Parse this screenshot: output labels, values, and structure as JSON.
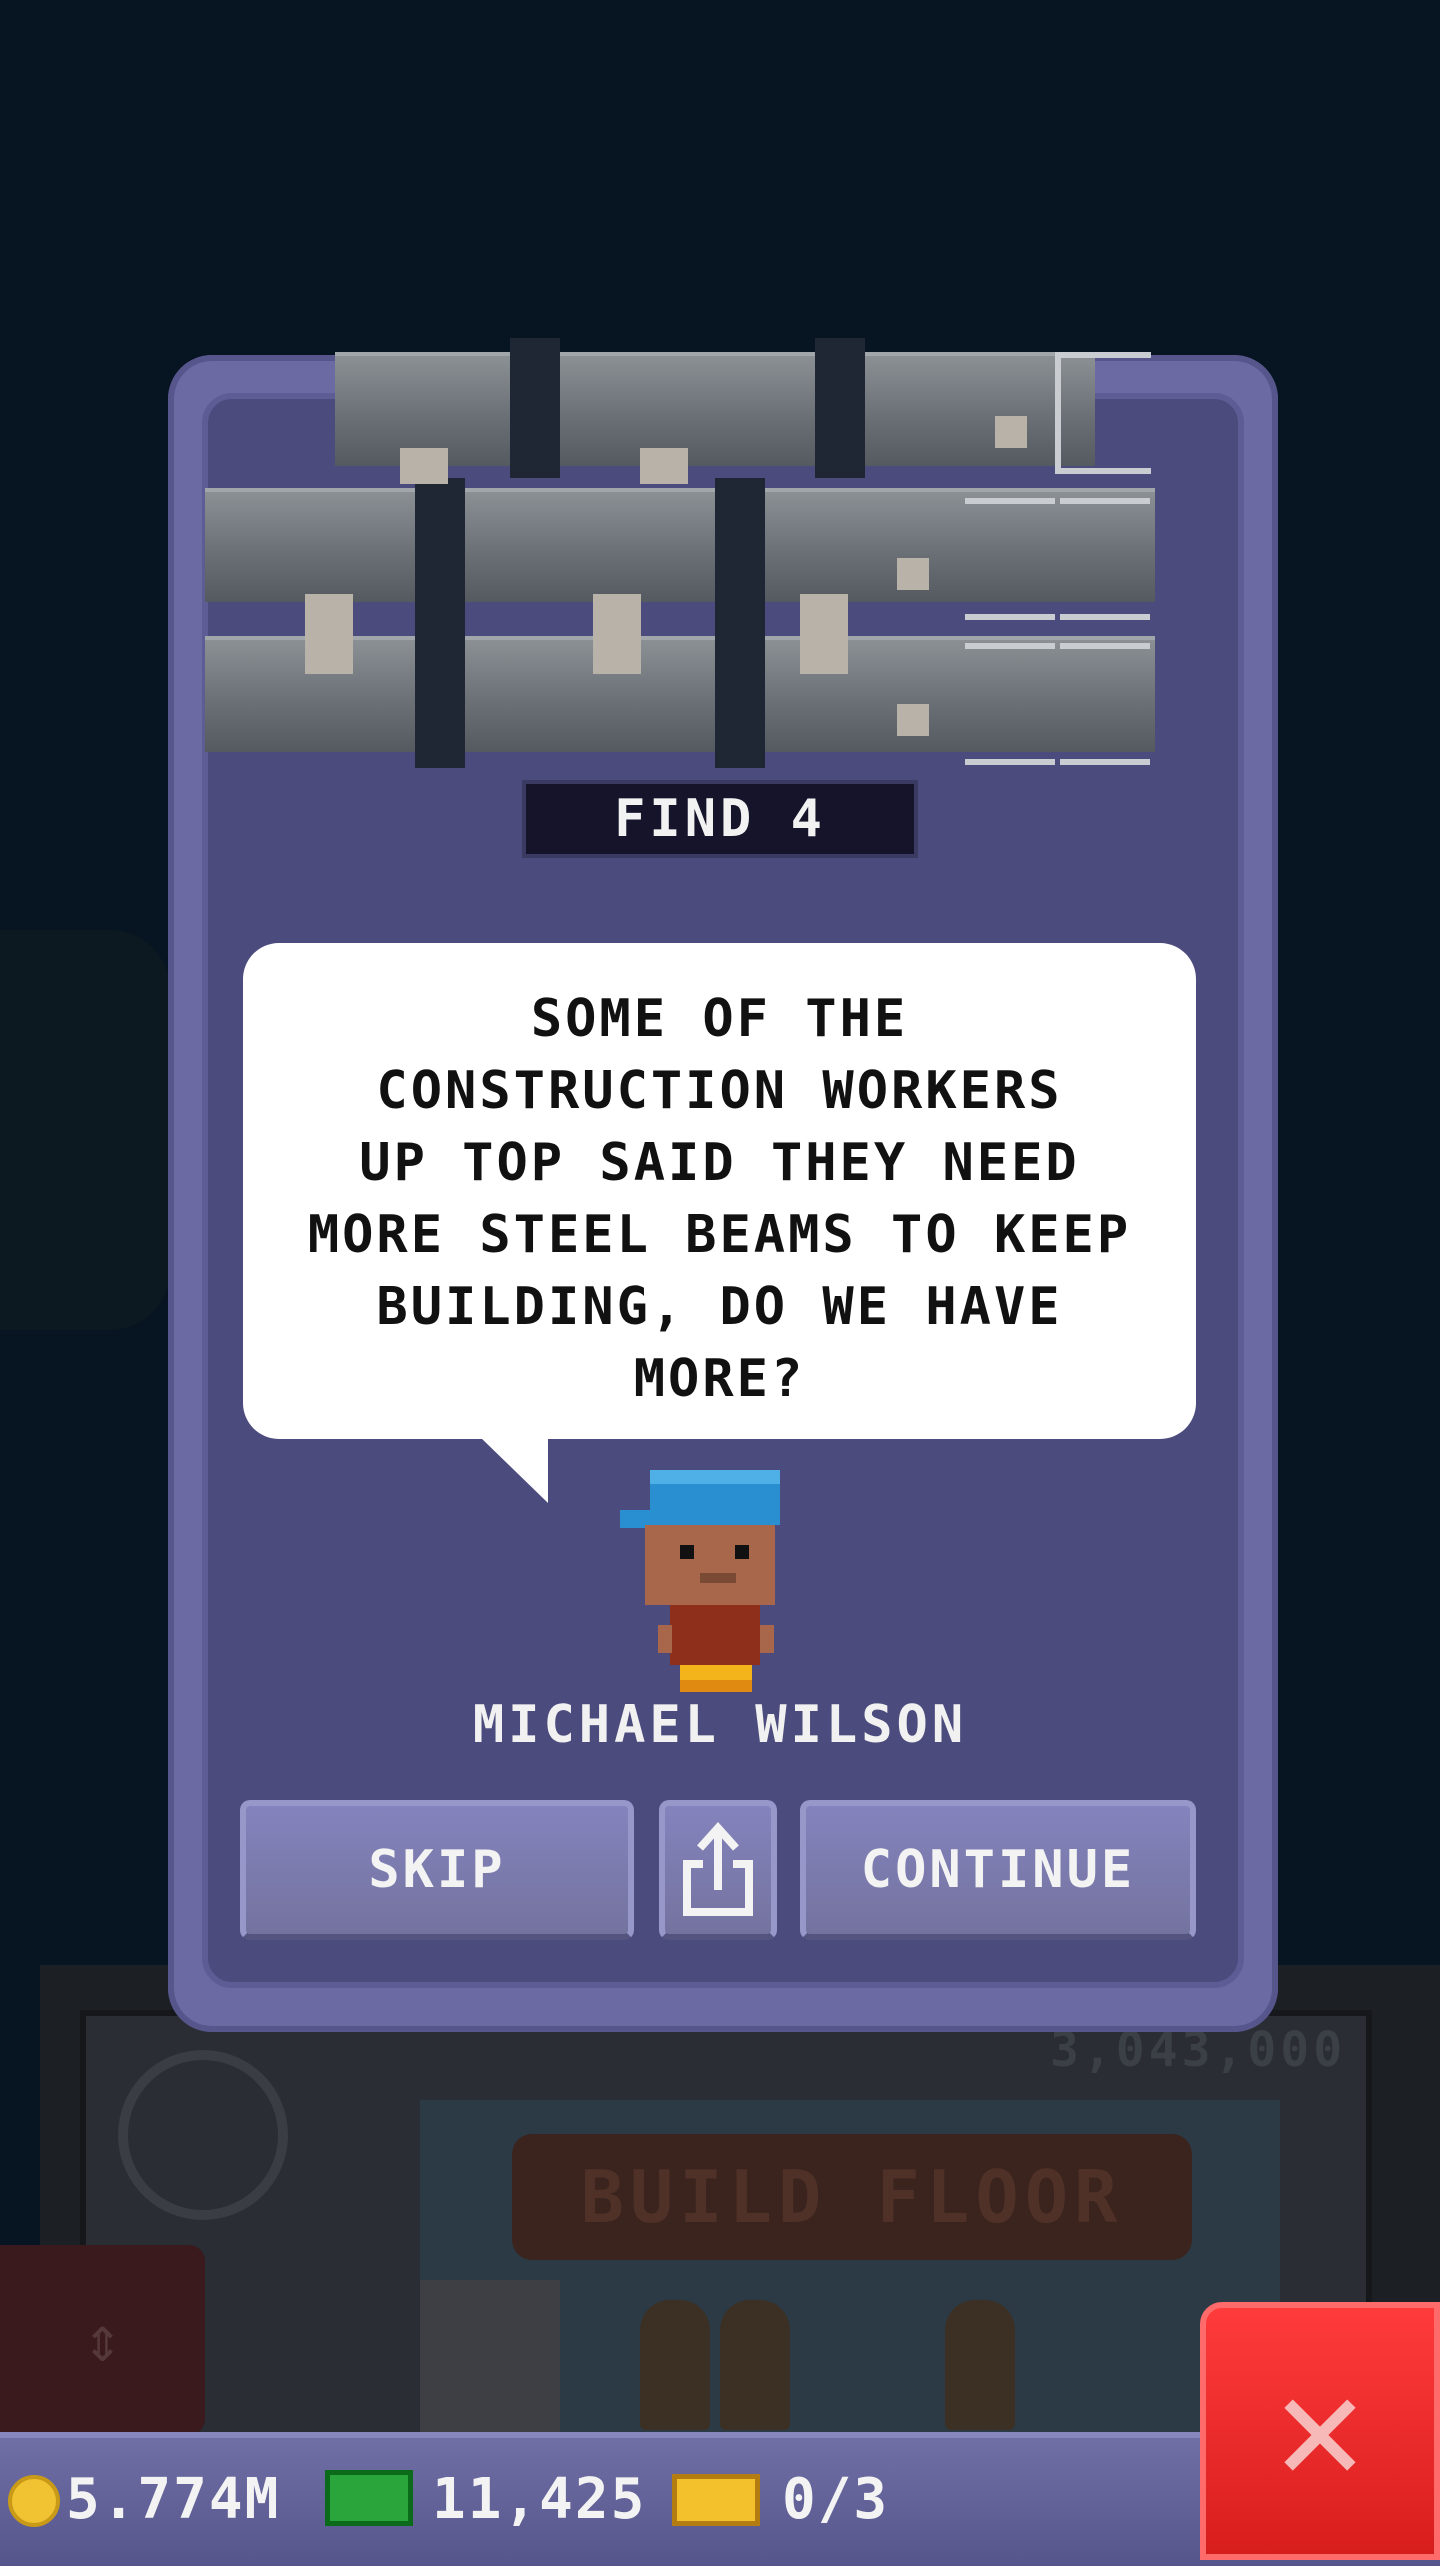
{
  "dialog": {
    "find_label": "FIND 4",
    "speech": "SOME OF THE\nCONSTRUCTION WORKERS\nUP TOP SAID THEY NEED\nMORE STEEL BEAMS TO KEEP\nBUILDING, DO WE HAVE\nMORE?",
    "character_name": "MICHAEL WILSON",
    "buttons": {
      "skip": "SKIP",
      "continue": "CONTINUE"
    }
  },
  "background": {
    "floor_cost": "3,043,000",
    "build_floor": "BUILD FLOOR"
  },
  "status_bar": {
    "coins": "5.774M",
    "bux": "11,425",
    "gold_tickets": "0/3"
  },
  "colors": {
    "dialog_outer": "#6b6aa3",
    "dialog_inner": "#4c4b7d",
    "close_button": "#e52626"
  }
}
